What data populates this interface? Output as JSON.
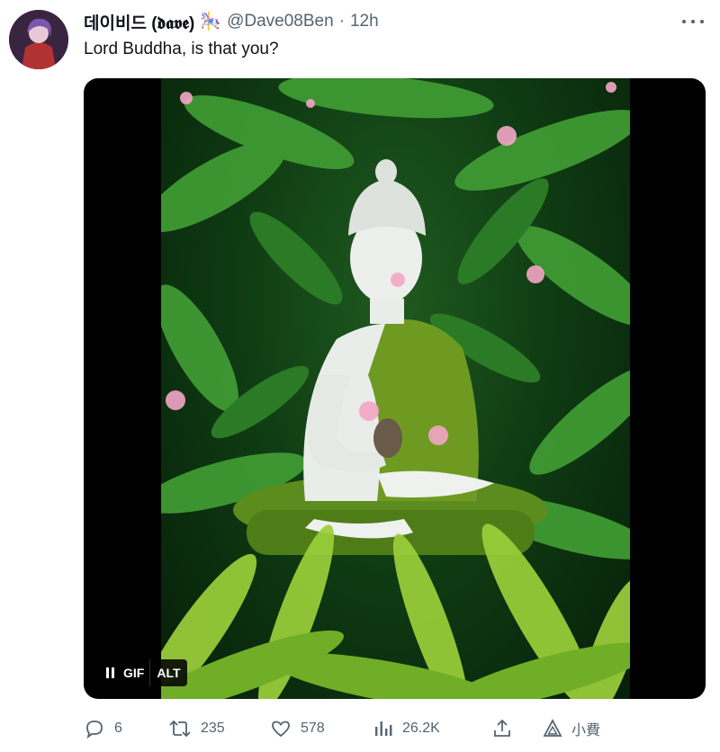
{
  "tweet": {
    "display_name": "데이비드 (𝖉𝖆𝖛𝖊)",
    "name_emoji": "🎠",
    "handle": "@Dave08Ben",
    "separator": "·",
    "time": "12h",
    "text": "Lord Buddha, is that you?"
  },
  "media": {
    "gif_label": "GIF",
    "alt_label": "ALT"
  },
  "actions": {
    "replies": "6",
    "reposts": "235",
    "likes": "578",
    "views": "26.2K",
    "tip_label": "小費"
  },
  "colors": {
    "text_primary": "#0f1419",
    "text_secondary": "#536471",
    "media_bg": "#000000",
    "foliage": "#2f7d2a",
    "statue": "#e9ede9",
    "robe": "#6f9a22"
  },
  "icons": [
    "more-icon",
    "pause-icon",
    "reply-icon",
    "repost-icon",
    "like-icon",
    "views-icon",
    "share-icon",
    "tip-icon"
  ]
}
